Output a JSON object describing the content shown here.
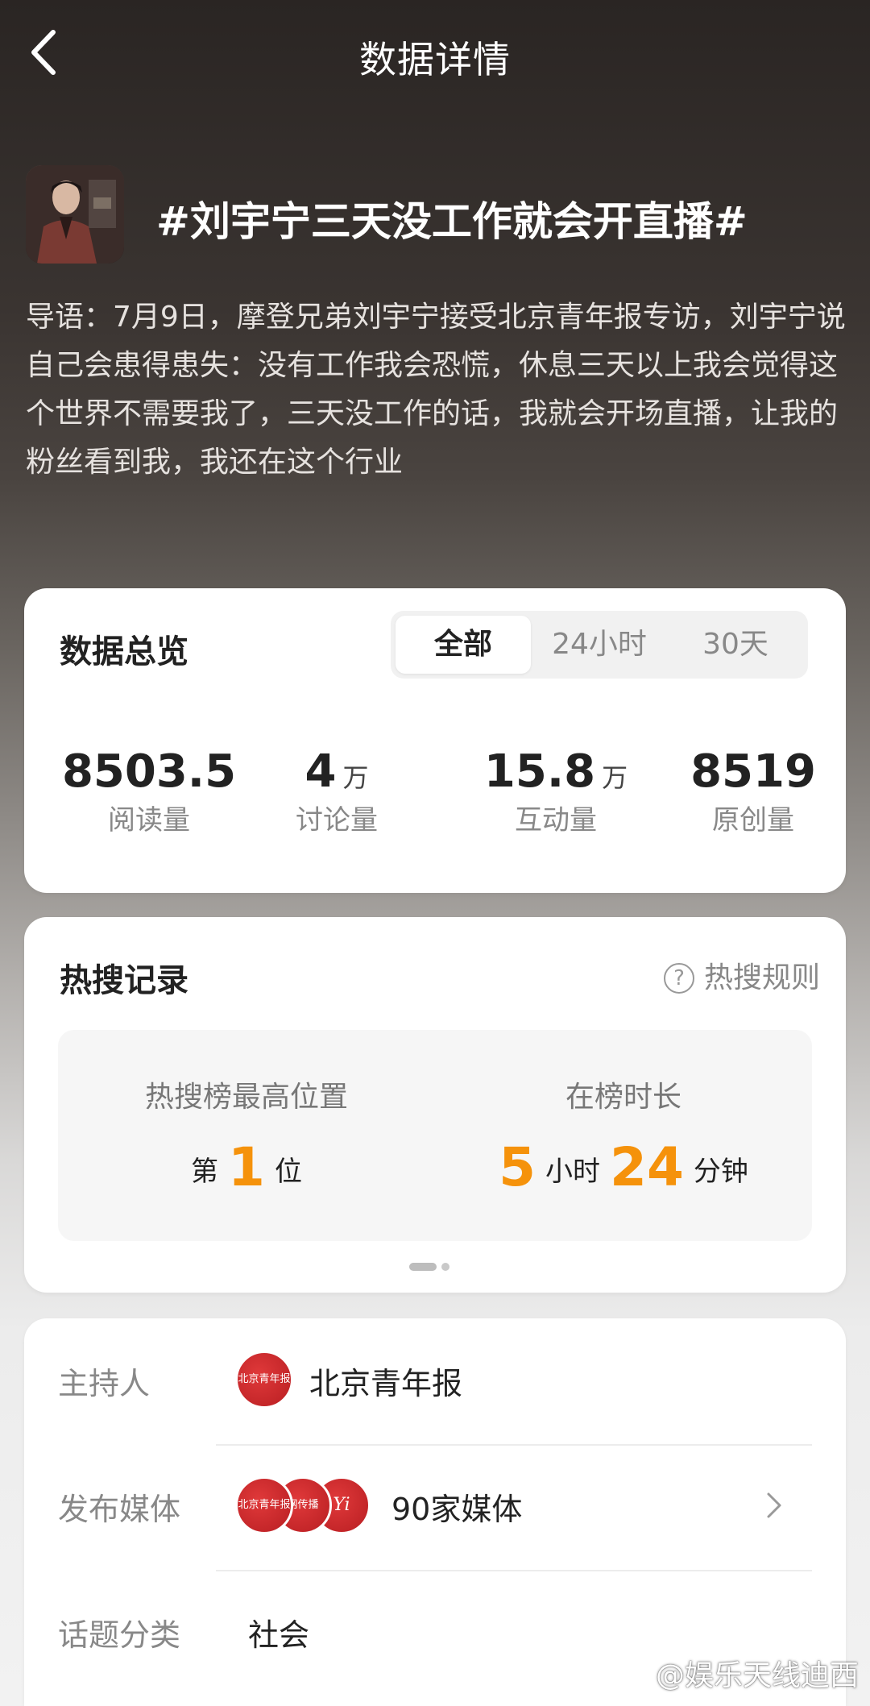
{
  "header": {
    "title": "数据详情"
  },
  "topic": {
    "title": "#刘宇宁三天没工作就会开直播#",
    "intro": "导语：7月9日，摩登兄弟刘宇宁接受北京青年报专访，刘宇宁说自己会患得患失：没有工作我会恐慌，休息三天以上我会觉得这个世界不需要我了，三天没工作的话，我就会开场直播，让我的粉丝看到我，我还在这个行业"
  },
  "overview": {
    "title": "数据总览",
    "tabs": [
      "全部",
      "24小时",
      "30天"
    ],
    "active_tab": "全部",
    "stats": [
      {
        "value": "8503.5",
        "unit": "",
        "label": "阅读量"
      },
      {
        "value": "4",
        "unit": "万",
        "label": "讨论量"
      },
      {
        "value": "15.8",
        "unit": "万",
        "label": "互动量"
      },
      {
        "value": "8519",
        "unit": "",
        "label": "原创量"
      }
    ]
  },
  "hot": {
    "title": "热搜记录",
    "rule_link": "热搜规则",
    "rule_icon_glyph": "?",
    "best_label": "热搜榜最高位置",
    "best_prefix": "第",
    "best_value": "1",
    "best_suffix": "位",
    "duration_label": "在榜时长",
    "hours": "5",
    "hours_unit": "小时",
    "minutes": "24",
    "minutes_unit": "分钟",
    "accent_color": "#f5920b"
  },
  "info": {
    "host_label": "主持人",
    "host_value": "北京青年报",
    "media_label": "发布媒体",
    "media_value": "90家媒体",
    "media_logos": [
      "北京青年报",
      "网传播",
      "Yi"
    ],
    "category_label": "话题分类",
    "category_value": "社会"
  },
  "watermark": {
    "text": "@娱乐天线迪西"
  }
}
